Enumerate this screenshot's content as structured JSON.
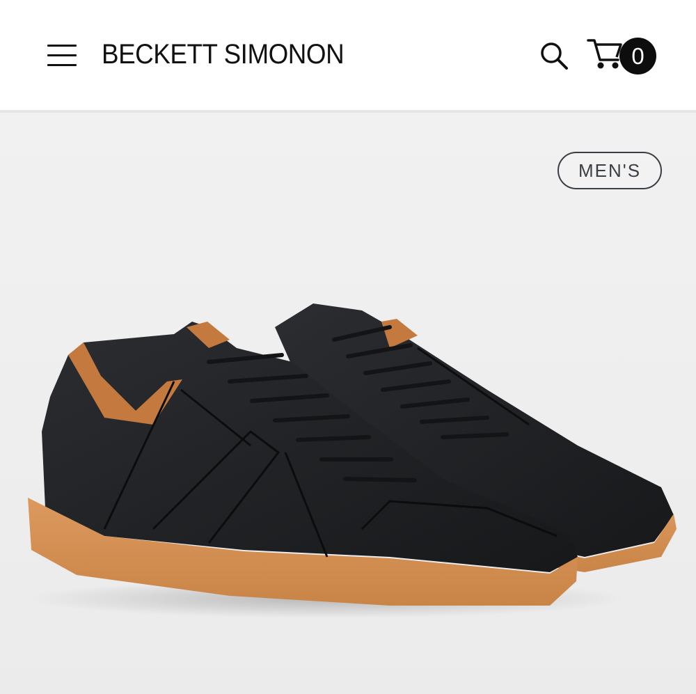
{
  "header": {
    "brand": "BECKETT SIMONON",
    "menu_icon": "hamburger-menu-icon",
    "search_icon": "search-icon",
    "cart_icon": "cart-icon",
    "cart_count": "0"
  },
  "hero": {
    "category_badge": "MEN'S",
    "image_subject": "black leather low-top sneakers with gum sole",
    "colors": {
      "upper": "#1f2124",
      "sole": "#d18c52",
      "lining": "#c47a3e",
      "background": "#eeeeee"
    }
  }
}
